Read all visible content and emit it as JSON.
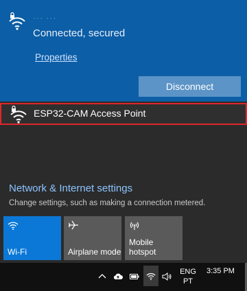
{
  "connected_network": {
    "status": "Connected, secured",
    "properties_label": "Properties",
    "disconnect_label": "Disconnect",
    "icon": "wifi-secured-icon"
  },
  "networks": [
    {
      "name": "ESP32-CAM Access Point",
      "icon": "wifi-secured-icon"
    }
  ],
  "settings": {
    "title": "Network & Internet settings",
    "description": "Change settings, such as making a connection metered."
  },
  "quick_actions": [
    {
      "label": "Wi-Fi",
      "icon": "wifi-icon",
      "active": true
    },
    {
      "label": "Airplane mode",
      "icon": "airplane-icon",
      "active": false
    },
    {
      "label": "Mobile\nhotspot",
      "icon": "hotspot-icon",
      "active": false
    }
  ],
  "taskbar": {
    "language_line1": "ENG",
    "language_line2": "PT",
    "time": "3:35 PM"
  },
  "colors": {
    "connected_bg": "#0c5ea6",
    "highlight_border": "#e0262c",
    "tile_active": "#0b78d7",
    "tile_inactive": "#5a5a5a",
    "link": "#8cc4ff"
  }
}
